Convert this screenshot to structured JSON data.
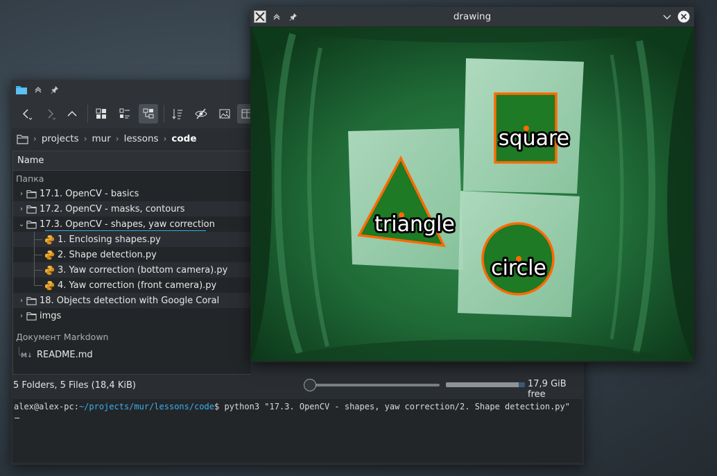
{
  "file_manager": {
    "breadcrumb": [
      "projects",
      "mur",
      "lessons",
      "code"
    ],
    "column_header": "Name",
    "groups": {
      "folder_label": "Папка",
      "markdown_label": "Документ Markdown"
    },
    "folders": [
      "17.1. OpenCV - basics",
      "17.2. OpenCV - masks, contours",
      "17.3. OpenCV - shapes, yaw correction",
      "18. Objects detection with Google Coral",
      "imgs"
    ],
    "expanded_children": [
      "1. Enclosing shapes.py",
      "2. Shape detection.py",
      "3. Yaw correction (bottom camera).py",
      "4. Yaw correction (front camera).py"
    ],
    "markdown_files": [
      "README.md"
    ],
    "status": {
      "summary": "5 Folders, 5 Files (18,4 KiB)",
      "free_space": "17,9 GiB free",
      "zoom_level": 0,
      "disk_used_fraction": 0.92
    }
  },
  "terminal": {
    "user_host": "alex@alex-pc",
    "path": "~/projects/mur/lessons/code",
    "prompt_suffix": "$ ",
    "command": "python3 \"17.3. OpenCV - shapes, yaw correction/2. Shape detection.py\""
  },
  "opencv_window": {
    "title": "drawing",
    "labels": {
      "square": "square",
      "triangle": "triangle",
      "circle": "circle"
    },
    "contour_color": "#ff6a00",
    "fill_color": "#1e7a24"
  },
  "colors": {
    "accent": "#3daee9",
    "window_bg": "#2a2e32"
  }
}
